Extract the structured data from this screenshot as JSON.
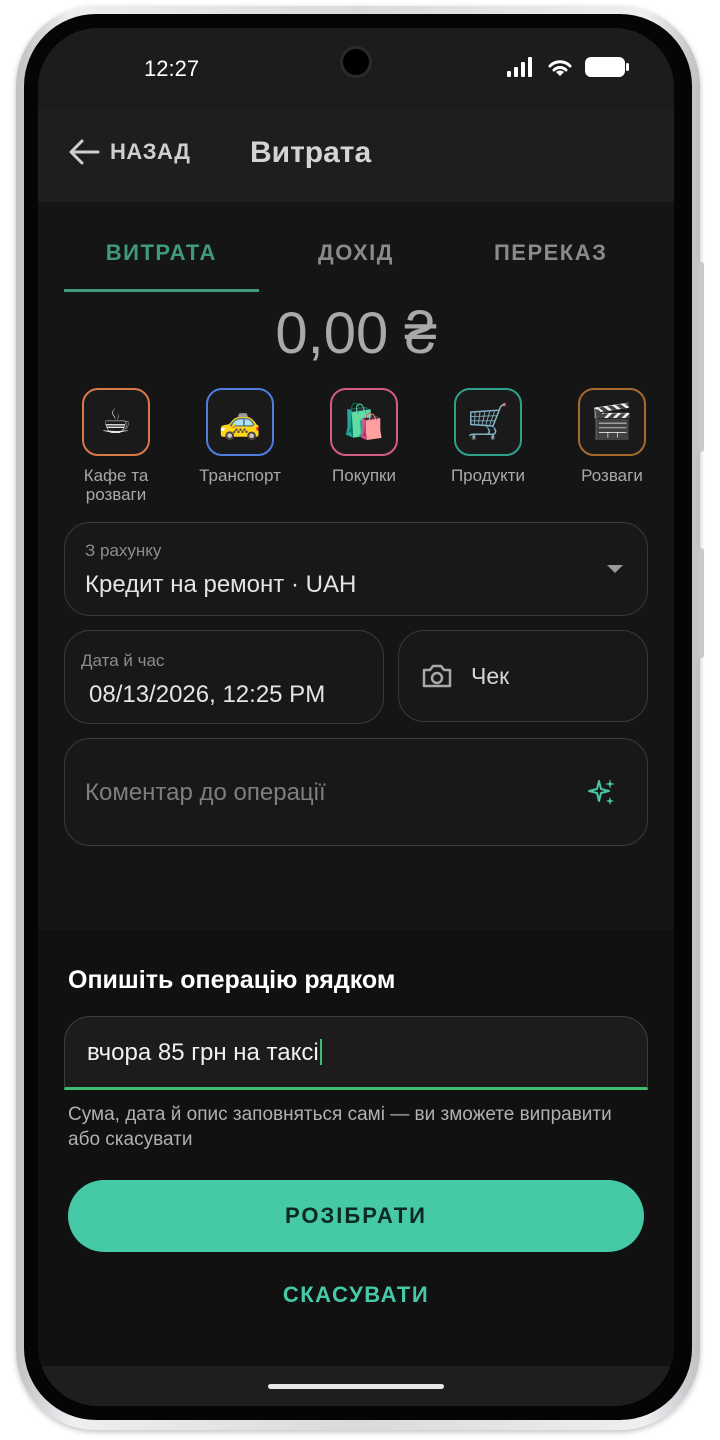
{
  "status_bar": {
    "time": "12:27"
  },
  "app_bar": {
    "back_label": "НАЗАД",
    "title": "Витрата"
  },
  "tabs": [
    {
      "label": "ВИТРАТА",
      "active": true
    },
    {
      "label": "ДОХІД",
      "active": false
    },
    {
      "label": "ПЕРЕКАЗ",
      "active": false
    }
  ],
  "amount": "0,00 ₴",
  "categories": [
    {
      "label": "Кафе та розваги",
      "icon": "coffee-icon",
      "glyph": "☕",
      "color": "#d9794a"
    },
    {
      "label": "Транспорт",
      "icon": "taxi-icon",
      "glyph": "🚕",
      "color": "#4f7de0"
    },
    {
      "label": "Покупки",
      "icon": "shopping-bags-icon",
      "glyph": "🛍️",
      "color": "#d45a8a"
    },
    {
      "label": "Продукти",
      "icon": "shopping-cart-icon",
      "glyph": "🛒",
      "color": "#2fa08a"
    },
    {
      "label": "Розваги",
      "icon": "clapper-icon",
      "glyph": "🎬",
      "color": "#a56a2c"
    }
  ],
  "account_field": {
    "label": "З рахунку",
    "value": "Кредит на ремонт · UAH"
  },
  "date_field": {
    "label": "Дата й час",
    "value": "08/13/2026, 12:25 PM"
  },
  "receipt_button": {
    "label": "Чек"
  },
  "comment_field": {
    "placeholder": "Коментар до операції"
  },
  "sheet": {
    "title": "Опишіть операцію рядком",
    "input_value": "вчора 85 грн на таксі",
    "helper": "Сума, дата й опис заповняться самі — ви зможете виправити або скасувати",
    "parse_button": "РОЗІБРАТИ",
    "cancel_button": "СКАСУВАТИ"
  },
  "colors": {
    "accent": "#45c9a6",
    "tab_active": "#3f9a7d",
    "input_focus": "#3bbf6e"
  }
}
